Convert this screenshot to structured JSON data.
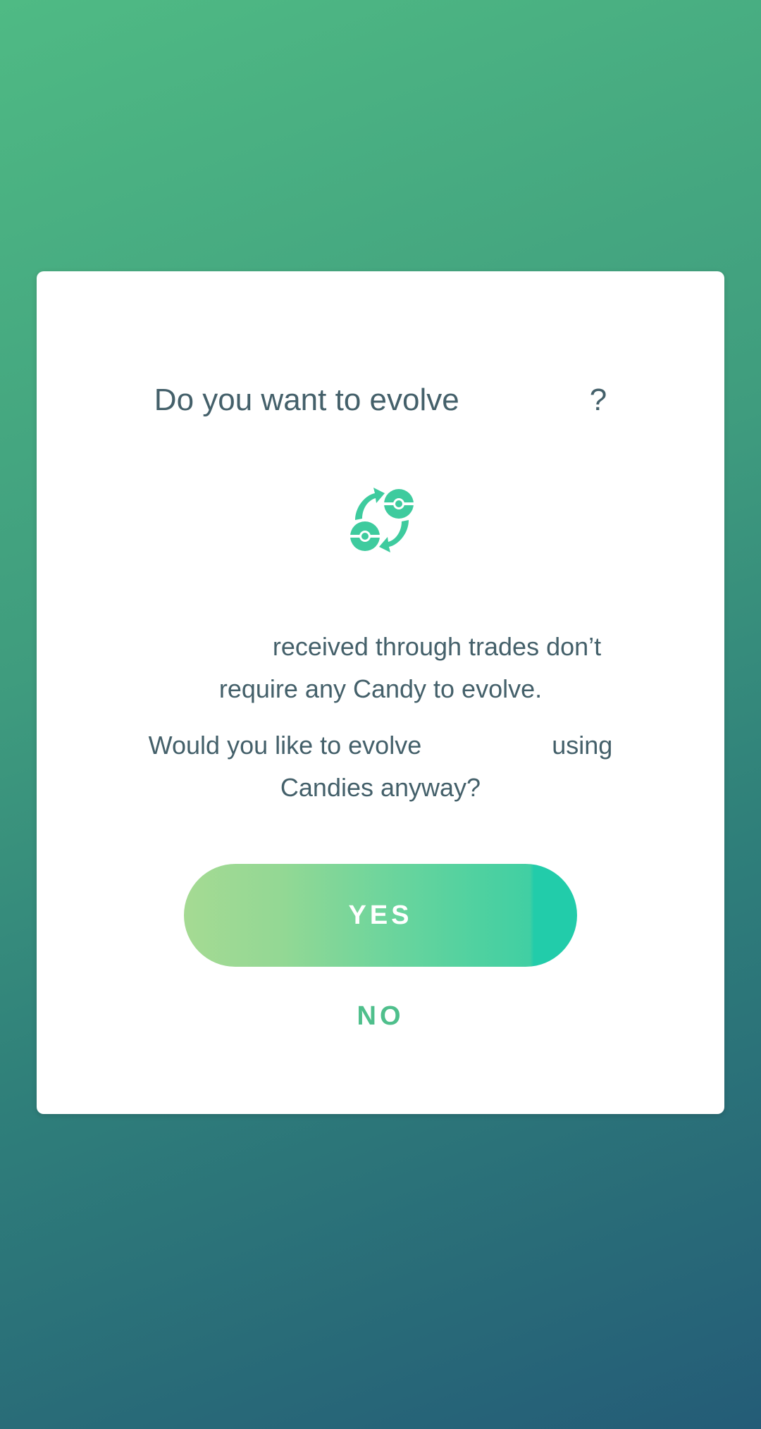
{
  "colors": {
    "accent": "#4fbf8c",
    "text": "#44606a",
    "dialog_bg": "#ffffff"
  },
  "dialog": {
    "title_prefix": "Do you want to evolve",
    "title_suffix": "?",
    "icon": "evolve-trade-icon",
    "message_line1": "received through trades don’t",
    "message_line2": "require any Candy to evolve.",
    "question_prefix": "Would you like to evolve",
    "question_suffix": "using",
    "question_line2": "Candies anyway?",
    "yes_label": "YES",
    "no_label": "NO"
  }
}
